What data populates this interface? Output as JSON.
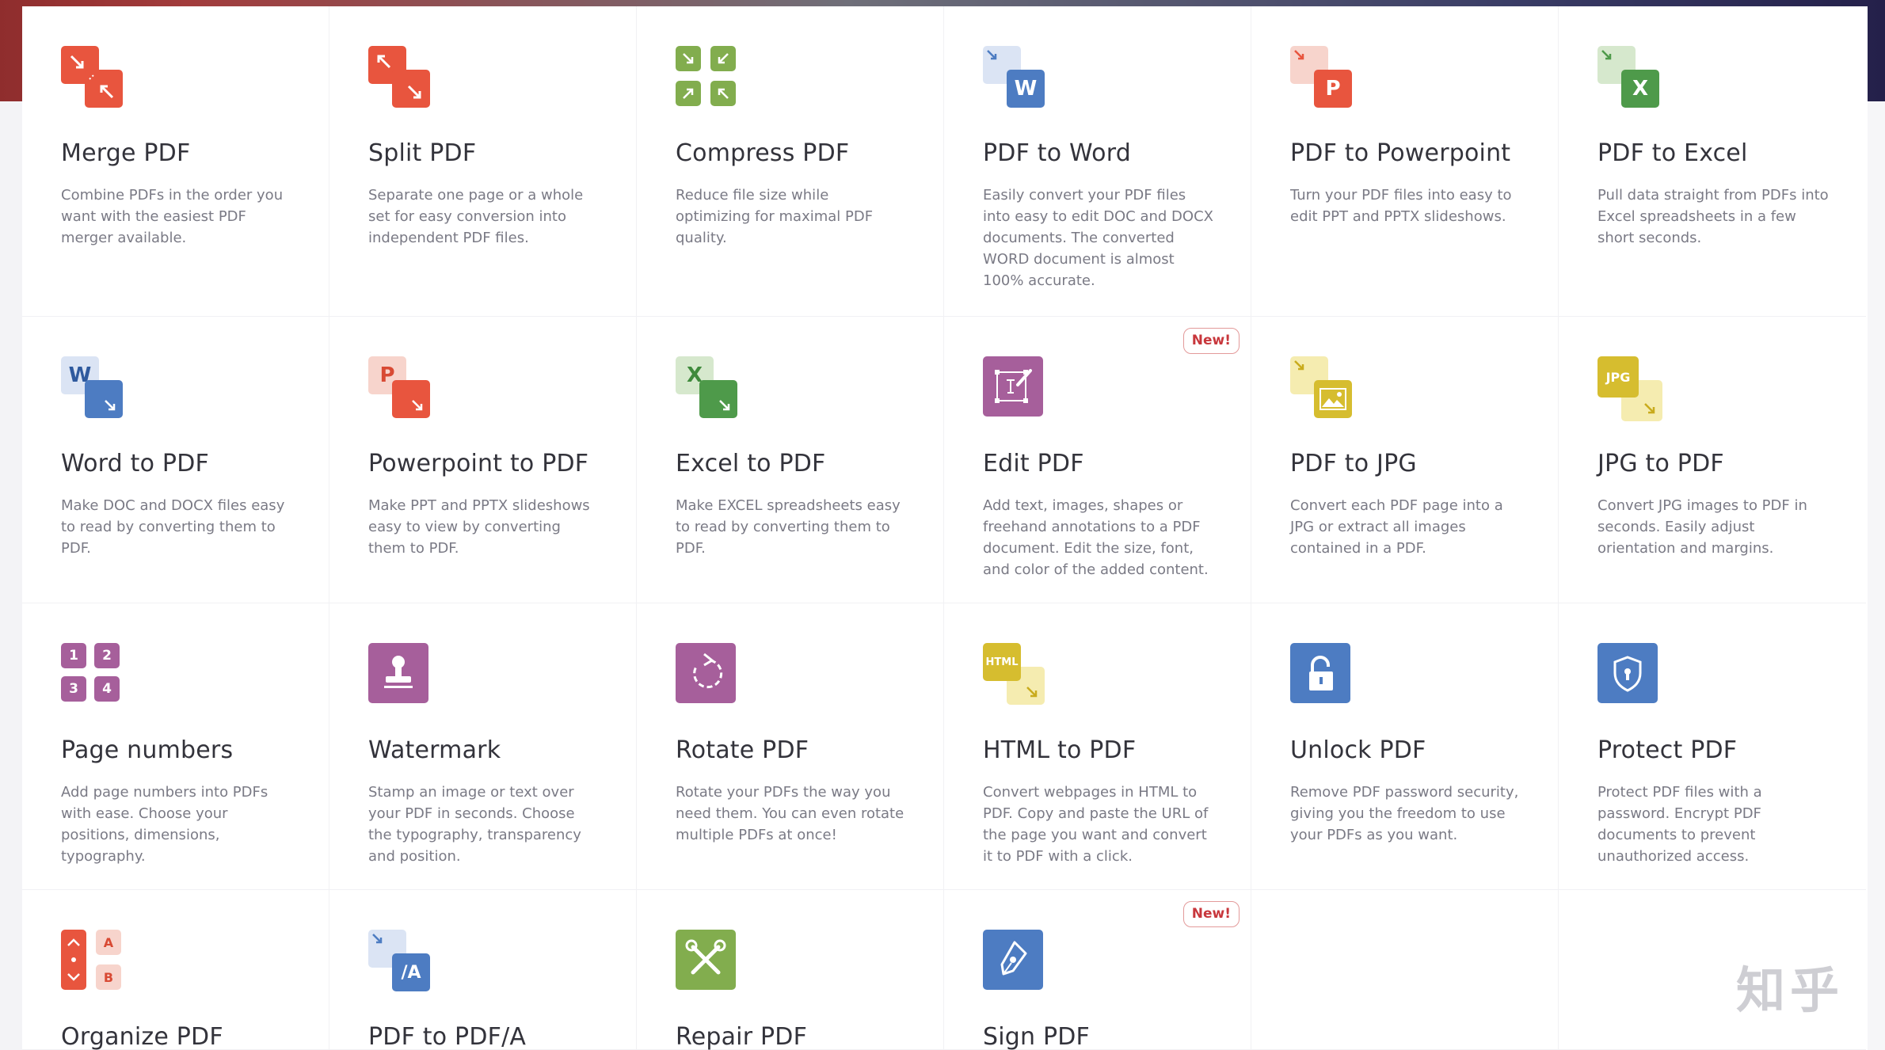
{
  "colors": {
    "orange": "#e8553e",
    "green": "#82ad4e",
    "blue": "#4d7cc2",
    "purple": "#a65f9b",
    "yellow": "#d8c13a",
    "new_badge": "#c8373c"
  },
  "tools": [
    {
      "title": "Merge PDF",
      "desc": "Combine PDFs in the order you want with the easiest PDF merger available.",
      "icon": "merge-icon"
    },
    {
      "title": "Split PDF",
      "desc": "Separate one page or a whole set for easy conversion into independent PDF files.",
      "icon": "split-icon"
    },
    {
      "title": "Compress PDF",
      "desc": "Reduce file size while optimizing for maximal PDF quality.",
      "icon": "compress-icon"
    },
    {
      "title": "PDF to Word",
      "desc": "Easily convert your PDF files into easy to edit DOC and DOCX documents. The converted WORD document is almost 100% accurate.",
      "icon": "pdf-to-word-icon",
      "letter": "W"
    },
    {
      "title": "PDF to Powerpoint",
      "desc": "Turn your PDF files into easy to edit PPT and PPTX slideshows.",
      "icon": "pdf-to-powerpoint-icon",
      "letter": "P"
    },
    {
      "title": "PDF to Excel",
      "desc": "Pull data straight from PDFs into Excel spreadsheets in a few short seconds.",
      "icon": "pdf-to-excel-icon",
      "letter": "X"
    },
    {
      "title": "Word to PDF",
      "desc": "Make DOC and DOCX files easy to read by converting them to PDF.",
      "icon": "word-to-pdf-icon",
      "letter": "W"
    },
    {
      "title": "Powerpoint to PDF",
      "desc": "Make PPT and PPTX slideshows easy to view by converting them to PDF.",
      "icon": "powerpoint-to-pdf-icon",
      "letter": "P"
    },
    {
      "title": "Excel to PDF",
      "desc": "Make EXCEL spreadsheets easy to read by converting them to PDF.",
      "icon": "excel-to-pdf-icon",
      "letter": "X"
    },
    {
      "title": "Edit PDF",
      "desc": "Add text, images, shapes or freehand annotations to a PDF document. Edit the size, font, and color of the added content.",
      "icon": "edit-pdf-icon",
      "badge": "New!"
    },
    {
      "title": "PDF to JPG",
      "desc": "Convert each PDF page into a JPG or extract all images contained in a PDF.",
      "icon": "pdf-to-jpg-icon"
    },
    {
      "title": "JPG to PDF",
      "desc": "Convert JPG images to PDF in seconds. Easily adjust orientation and margins.",
      "icon": "jpg-to-pdf-icon",
      "letter": "JPG"
    },
    {
      "title": "Page numbers",
      "desc": "Add page numbers into PDFs with ease. Choose your positions, dimensions, typography.",
      "icon": "page-numbers-icon",
      "digits": [
        "1",
        "2",
        "3",
        "4"
      ]
    },
    {
      "title": "Watermark",
      "desc": "Stamp an image or text over your PDF in seconds. Choose the typography, transparency and position.",
      "icon": "stamp-icon"
    },
    {
      "title": "Rotate PDF",
      "desc": "Rotate your PDFs the way you need them. You can even rotate multiple PDFs at once!",
      "icon": "rotate-icon"
    },
    {
      "title": "HTML to PDF",
      "desc": "Convert webpages in HTML to PDF. Copy and paste the URL of the page you want and convert it to PDF with a click.",
      "icon": "html-to-pdf-icon",
      "letter": "HTML"
    },
    {
      "title": "Unlock PDF",
      "desc": "Remove PDF password security, giving you the freedom to use your PDFs as you want.",
      "icon": "unlock-icon"
    },
    {
      "title": "Protect PDF",
      "desc": "Protect PDF files with a password. Encrypt PDF documents to prevent unauthorized access.",
      "icon": "shield-icon"
    },
    {
      "title": "Organize PDF",
      "desc": "",
      "icon": "organize-icon",
      "letters": [
        "A",
        "B"
      ]
    },
    {
      "title": "PDF to PDF/A",
      "desc": "",
      "icon": "pdf-to-pdfa-icon",
      "letter": "/A"
    },
    {
      "title": "Repair PDF",
      "desc": "",
      "icon": "repair-icon"
    },
    {
      "title": "Sign PDF",
      "desc": "",
      "icon": "sign-pen-icon",
      "badge": "New!"
    }
  ],
  "watermark_text": "知乎"
}
